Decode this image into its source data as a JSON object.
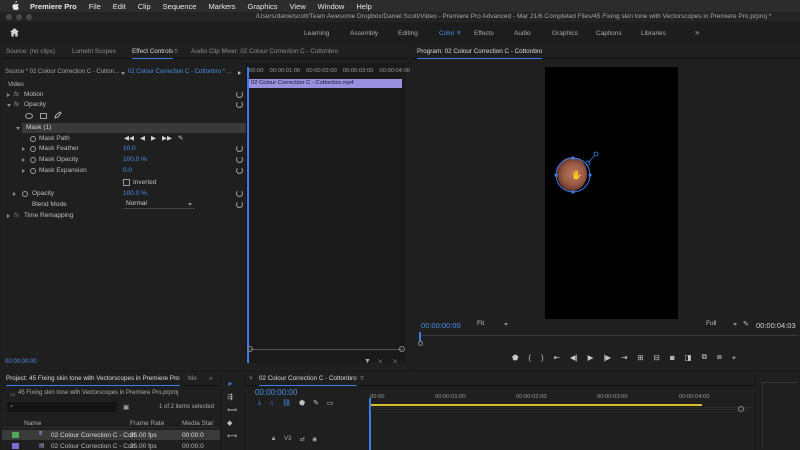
{
  "menubar": {
    "app": "Premiere Pro",
    "items": [
      "File",
      "Edit",
      "Clip",
      "Sequence",
      "Markers",
      "Graphics",
      "View",
      "Window",
      "Help"
    ]
  },
  "titlebar": {
    "path": "/Users/danielscott/Team Awesome Dropbox/Daniel Scott/Video - Premiere Pro Advanced - Mar 21/6 Completed Files/45 Fixing skin tone with Vectorscopes in Premiere Pro.prproj *"
  },
  "workspaces": {
    "items": [
      "Learning",
      "Assembly",
      "Editing",
      "Color",
      "Effects",
      "Audio",
      "Graphics",
      "Captions",
      "Libraries"
    ],
    "active": "Color",
    "more": "»"
  },
  "effect_panel": {
    "tabs": [
      "Source: (no clips)",
      "Lumetri Scopes",
      "Effect Controls",
      "Audio Clip Mixer: 02 Colour Correction C - Cottonbro"
    ],
    "active_tab": "Effect Controls",
    "source_label": "Source * 02 Colour Correction C - Cotton...",
    "sequence_label": "02 Colour Correction C - Cottonbro * ...",
    "timecodes": [
      "00:00",
      "00:00:01:00",
      "00:00:02:00",
      "00:00:03:00",
      "00:00:04:00"
    ],
    "clip_name": "02 Colour Correction C - Cottonbro.mp4",
    "section_video": "Video",
    "motion": "Motion",
    "opacity": "Opacity",
    "mask": "Mask (1)",
    "mask_path": "Mask Path",
    "mask_feather": "Mask Feather",
    "mask_feather_val": "10.0",
    "mask_opacity": "Mask Opacity",
    "mask_opacity_val": "100.0 %",
    "mask_expansion": "Mask Expansion",
    "mask_expansion_val": "0.0",
    "inverted": "Inverted",
    "opacity_row": "Opacity",
    "opacity_val": "100.0 %",
    "blend_mode": "Blend Mode",
    "blend_mode_val": "Normal",
    "time_remapping": "Time Remapping",
    "fx": "fx",
    "footer_time": "00:00:00:00"
  },
  "program": {
    "title": "Program: 02 Colour Correction C - Cottonbro",
    "timecode": "00:00:00:00",
    "fit": "Fit",
    "quality": "Full",
    "duration": "00:00:04:03"
  },
  "project": {
    "tab": "Project: 45 Fixing skin tone with Vectorscopes in Premiere Pro",
    "tab2": "Me",
    "more": "»",
    "file": "45 Fixing skin tone with Vectorscopes in Premiere Pro.prproj",
    "items_selected": "1 of 2 items selected",
    "col_name": "Name",
    "col_rate": "Frame Rate",
    "col_media": "Media Star",
    "rows": [
      {
        "name": "02 Colour Correction C - Cott",
        "rate": "25.00 fps",
        "start": "00:00:0"
      },
      {
        "name": "02 Colour Correction C - Cott",
        "rate": "25.00 fps",
        "start": "00:00:0"
      }
    ]
  },
  "timeline": {
    "tab": "02 Colour Correction C - Cottonbro",
    "timecode": "00:00:00:00",
    "ruler": [
      "00:00",
      "00:00:01:00",
      "00:00:02:00",
      "00:00:03:00",
      "00:00:04:00"
    ],
    "track": "V3"
  },
  "colors": {
    "accent": "#4a8fe6",
    "clip": "#9b8fe0",
    "playhead_bar": "#d7c22a"
  }
}
